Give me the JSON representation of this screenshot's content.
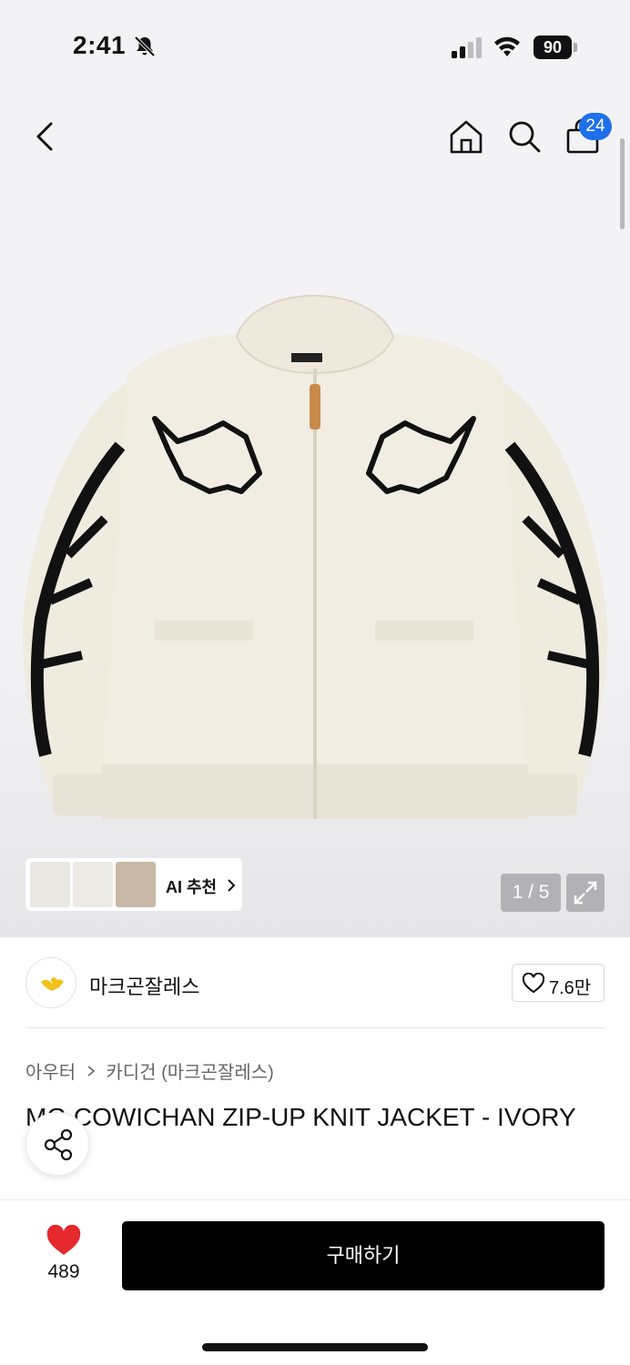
{
  "status_bar": {
    "time": "2:41",
    "battery": "90",
    "icons": [
      "bell-slash-icon",
      "cellular-signal-icon",
      "wifi-icon",
      "battery-icon"
    ]
  },
  "nav": {
    "icons": [
      "back-icon",
      "home-icon",
      "search-icon",
      "bag-icon"
    ],
    "cart_count": "24"
  },
  "gallery": {
    "ai_label": "AI 추천",
    "counter": "1 / 5",
    "image_description_icon": "cardigan-image"
  },
  "brand": {
    "name": "마크곤잘레스",
    "likes": "7.6만"
  },
  "product": {
    "breadcrumb": [
      "아우터",
      "카디건 (마크곤잘레스)"
    ],
    "title": "MG COWICHAN ZIP-UP KNIT JACKET - IVORY"
  },
  "bottom_bar": {
    "wish_count": "489",
    "buy_label": "구매하기"
  },
  "colors": {
    "accent_badge": "#1f6feb",
    "heart": "#e5292c",
    "buy_button": "#000000"
  }
}
